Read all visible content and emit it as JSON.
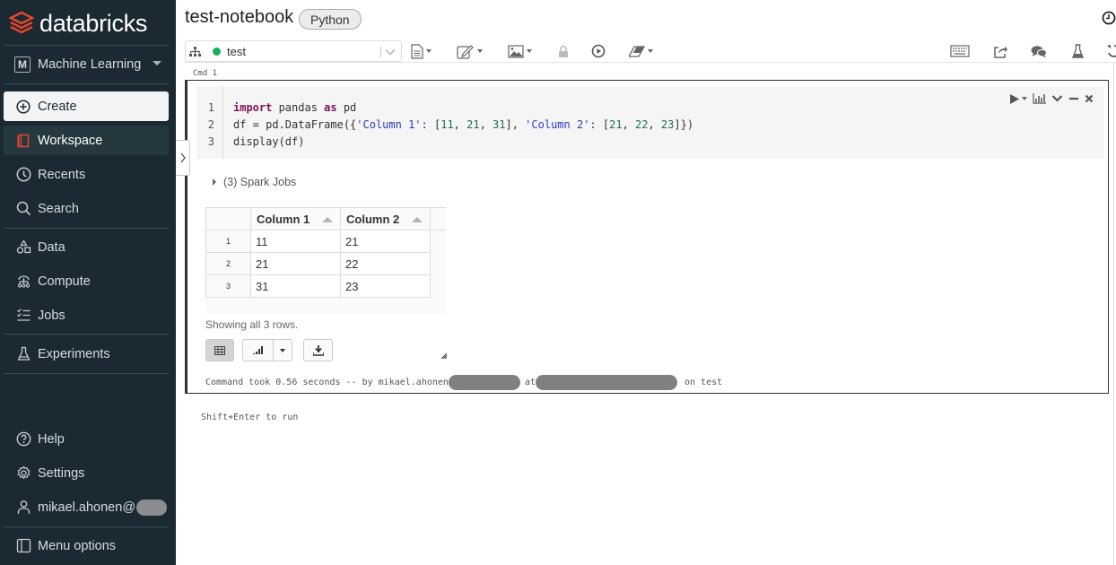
{
  "brand": {
    "name": "databricks",
    "accent": "#e8442e"
  },
  "sidebar": {
    "persona": {
      "badge": "M",
      "label": "Machine Learning"
    },
    "create": "Create",
    "items": [
      {
        "id": "workspace",
        "label": "Workspace",
        "icon": "workspace-icon",
        "active": true
      },
      {
        "id": "recents",
        "label": "Recents",
        "icon": "clock-icon"
      },
      {
        "id": "search",
        "label": "Search",
        "icon": "search-icon"
      },
      {
        "id": "data",
        "label": "Data",
        "icon": "data-icon"
      },
      {
        "id": "compute",
        "label": "Compute",
        "icon": "compute-icon"
      },
      {
        "id": "jobs",
        "label": "Jobs",
        "icon": "jobs-icon"
      },
      {
        "id": "experiments",
        "label": "Experiments",
        "icon": "flask-icon"
      }
    ],
    "bottom": {
      "help": "Help",
      "settings": "Settings",
      "user": "mikael.ahonen@",
      "menu_options": "Menu options"
    }
  },
  "header": {
    "notebook_title": "test-notebook",
    "language": "Python"
  },
  "toolbar": {
    "cluster": {
      "name": "test",
      "status_color": "#1aad5c"
    }
  },
  "cell": {
    "label": "Cmd 1",
    "code_lines": [
      {
        "n": "1",
        "text": "import pandas as pd"
      },
      {
        "n": "2",
        "text": "df = pd.DataFrame({'Column 1': [11, 21, 31], 'Column 2': [21, 22, 23]})"
      },
      {
        "n": "3",
        "text": "display(df)"
      }
    ],
    "code_tokens": {
      "l1": {
        "kw1": "import",
        "t1": " pandas ",
        "kw2": "as",
        "t2": " pd"
      },
      "l2": {
        "t1": "df = pd.DataFrame({",
        "s1": "'Column 1'",
        "t2": ": [",
        "n1": "11",
        "t3": ", ",
        "n2": "21",
        "t4": ", ",
        "n3": "31",
        "t5": "], ",
        "s2": "'Column 2'",
        "t6": ": [",
        "n4": "21",
        "t7": ", ",
        "n5": "22",
        "t8": ", ",
        "n6": "23",
        "t9": "]})"
      },
      "l3": {
        "t1": "display(df)"
      }
    },
    "spark_jobs": "(3) Spark Jobs",
    "result": {
      "columns": [
        "Column 1",
        "Column 2"
      ],
      "rows": [
        {
          "idx": "1",
          "values": [
            "11",
            "21"
          ]
        },
        {
          "idx": "2",
          "values": [
            "21",
            "22"
          ]
        },
        {
          "idx": "3",
          "values": [
            "31",
            "23"
          ]
        }
      ],
      "showing": "Showing all 3 rows."
    },
    "footer": {
      "prefix": "Command took 0.56 seconds -- by mikael.ahonen",
      "at": "at",
      "suffix": "on test"
    }
  },
  "hint": "Shift+Enter to run"
}
